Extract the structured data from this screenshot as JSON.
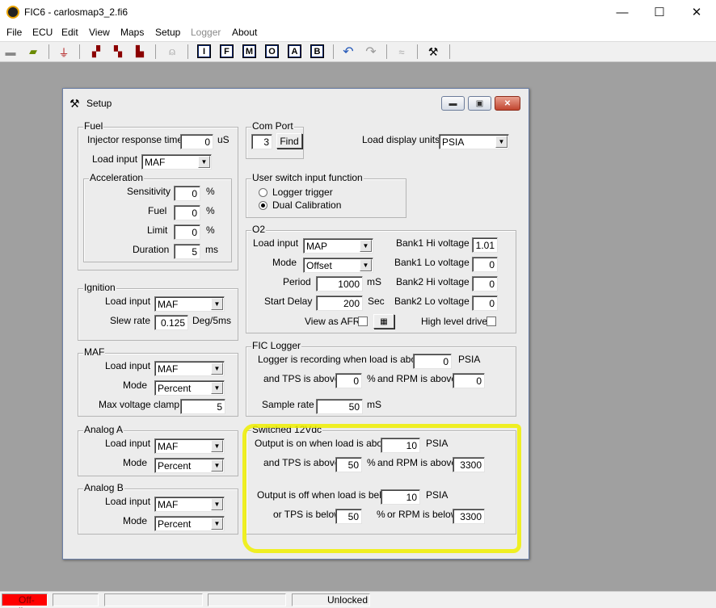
{
  "app": {
    "title": "FIC6 - carlosmap3_2.fi6",
    "window_controls": {
      "minimize": "—",
      "maximize": "☐",
      "close": "✕"
    }
  },
  "menu": [
    "File",
    "ECU",
    "Edit",
    "View",
    "Maps",
    "Setup",
    "Logger",
    "About"
  ],
  "toolbar": {
    "map_buttons": [
      "I",
      "F",
      "M",
      "O",
      "A",
      "B"
    ]
  },
  "dialog": {
    "title": "Setup",
    "fuel": {
      "label": "Fuel",
      "injector_response_label": "Injector response time",
      "injector_response_value": "0",
      "injector_response_unit": "uS",
      "load_input_label": "Load input",
      "load_input_value": "MAF",
      "acceleration": {
        "label": "Acceleration",
        "sensitivity_label": "Sensitivity",
        "sensitivity_value": "0",
        "sensitivity_unit": "%",
        "fuel_label": "Fuel",
        "fuel_value": "0",
        "fuel_unit": "%",
        "limit_label": "Limit",
        "limit_value": "0",
        "limit_unit": "%",
        "duration_label": "Duration",
        "duration_value": "5",
        "duration_unit": "ms"
      }
    },
    "ignition": {
      "label": "Ignition",
      "load_input_label": "Load input",
      "load_input_value": "MAF",
      "slew_rate_label": "Slew rate",
      "slew_rate_value": "0.125",
      "slew_rate_unit": "Deg/5ms"
    },
    "maf": {
      "label": "MAF",
      "load_input_label": "Load input",
      "load_input_value": "MAF",
      "mode_label": "Mode",
      "mode_value": "Percent",
      "max_clamp_label": "Max voltage clamp",
      "max_clamp_value": "5"
    },
    "analog_a": {
      "label": "Analog A",
      "load_input_label": "Load input",
      "load_input_value": "MAF",
      "mode_label": "Mode",
      "mode_value": "Percent"
    },
    "analog_b": {
      "label": "Analog B",
      "load_input_label": "Load input",
      "load_input_value": "MAF",
      "mode_label": "Mode",
      "mode_value": "Percent"
    },
    "com_port": {
      "label": "Com Port",
      "value": "3",
      "find_label": "Find"
    },
    "load_display": {
      "label": "Load display units",
      "value": "PSIA"
    },
    "user_switch": {
      "label": "User switch input function",
      "options": [
        "Logger trigger",
        "Dual Calibration"
      ],
      "selected": "Dual Calibration"
    },
    "o2": {
      "label": "O2",
      "load_input_label": "Load input",
      "load_input_value": "MAP",
      "mode_label": "Mode",
      "mode_value": "Offset",
      "period_label": "Period",
      "period_value": "1000",
      "period_unit": "mS",
      "start_delay_label": "Start Delay",
      "start_delay_value": "200",
      "start_delay_unit": "Sec",
      "view_afr_label": "View as AFR",
      "b1_hi_label": "Bank1 Hi voltage",
      "b1_hi_value": "1.01",
      "b1_lo_label": "Bank1 Lo voltage",
      "b1_lo_value": "0",
      "b2_hi_label": "Bank2 Hi voltage",
      "b2_hi_value": "0",
      "b2_lo_label": "Bank2 Lo voltage",
      "b2_lo_value": "0",
      "high_level_label": "High level drive"
    },
    "fic_logger": {
      "label": "FIC Logger",
      "recording_label": "Logger is recording when load is above",
      "recording_value": "0",
      "recording_unit": "PSIA",
      "tps_label": "and TPS is above",
      "tps_value": "0",
      "tps_unit": "%",
      "rpm_label": "and RPM is above",
      "rpm_value": "0",
      "sample_label": "Sample rate",
      "sample_value": "50",
      "sample_unit": "mS"
    },
    "switched": {
      "label": "Switched 12Vdc",
      "on_label": "Output is on when load is above",
      "on_value": "10",
      "on_unit": "PSIA",
      "on_tps_label": "and TPS is above",
      "on_tps_value": "50",
      "on_tps_unit": "%",
      "on_rpm_label": "and RPM is above",
      "on_rpm_value": "3300",
      "off_label": "Output is off when load is below",
      "off_value": "10",
      "off_unit": "PSIA",
      "off_tps_label": "or TPS is below",
      "off_tps_value": "50",
      "off_tps_unit": "%",
      "off_rpm_label": "or RPM is below",
      "off_rpm_value": "3300"
    }
  },
  "status": {
    "connection": "Off-line",
    "lock": "Unlocked"
  },
  "colors": {
    "offline": "#ff0000",
    "highlight": "#f0f000"
  }
}
